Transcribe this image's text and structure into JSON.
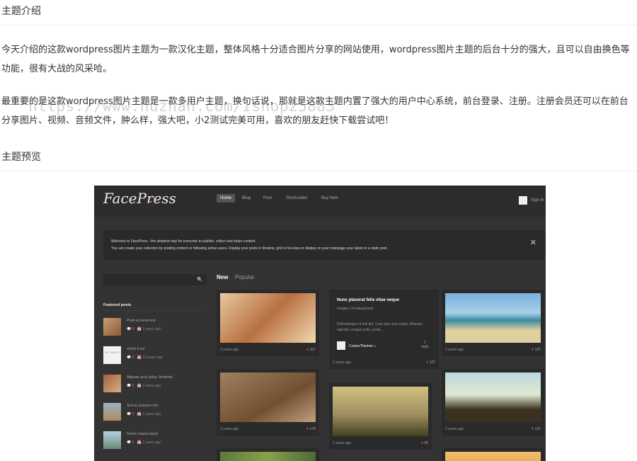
{
  "article": {
    "heading1": "主题介绍",
    "para1": "今天介绍的这款wordpress图片主题为一款汉化主题，整体风格十分适合图片分享的网站使用，wordpress图片主题的后台十分的强大，且可以自由换色等功能，很有大战的风采哈。",
    "para2": "最重要的是这款wordpress图片主题是一款多用户主题，换句话说，那就是这款主题内置了强大的用户中心系统，前台登录、注册。注册会员还可以在前台分享图片、视频、音频文件，肿么样，强大吧，小2测试完美可用，喜欢的朋友赶快下载尝试吧！",
    "watermark": "https://www.huzhan.com/ishop25883",
    "heading2": "主题预览"
  },
  "preview": {
    "logo": "FacePress",
    "nav": [
      "Home",
      "Blog",
      "Post",
      "Shortcodes",
      "Buy Item"
    ],
    "signin": "Sign in",
    "welcome_line1": "Welcome to FacePress - the simplest way for everyone to publish, collect and share content.",
    "welcome_line2": "You can create your collection by posting content or following active users. Display your posts in timeline, grid or list-view or display on your mainpage your latest or a static post.",
    "close": "✕",
    "search_icon": "🔍",
    "featured_title": "Featured posts",
    "featured": [
      {
        "title": "Proin eu lorem est",
        "comments": "0",
        "date": "2 years ago"
      },
      {
        "title": "check it out",
        "comments": "0",
        "date": "13 years ago",
        "thumb_text": "NO IMAGE"
      },
      {
        "title": "Aliquam arcu tellus, hendrerit",
        "comments": "0",
        "date": "2 years ago"
      },
      {
        "title": "Sed ac posuere nisl",
        "comments": "0",
        "date": "2 years ago"
      },
      {
        "title": "Donec massa turpis",
        "comments": "2",
        "date": "2 years ago"
      }
    ],
    "tabs": {
      "new": "New",
      "popular": "Popular"
    },
    "cards": [
      {
        "ago": "2 years ago",
        "likes": "107"
      },
      {
        "title": "Nunc placerat felis vitae neque",
        "cats": "Images, Uncategorized",
        "body": "Pellentesque id nisl dui. Cras quis urna turpis. Aliquam egestas congue justo, porta...",
        "author": "CosmoThemes",
        "replies": "1",
        "reply_label": "reply",
        "ago": "2 years ago",
        "likes": "127"
      },
      {
        "ago": "2 years ago",
        "likes": "121"
      },
      {
        "ago": "2 years ago",
        "likes": "179"
      },
      {
        "ago": "2 years ago",
        "likes": "95"
      },
      {
        "ago": "2 years ago",
        "likes": "121"
      }
    ],
    "heart": "♥"
  }
}
